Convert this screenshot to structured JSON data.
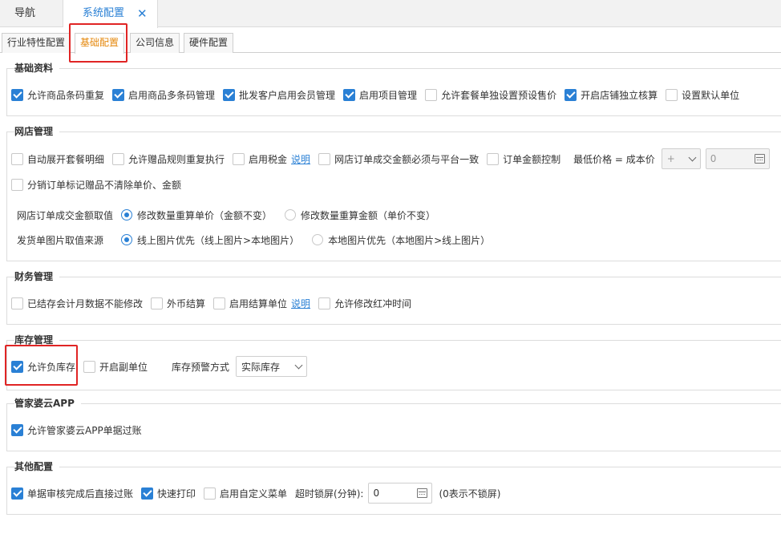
{
  "top_tabs": [
    {
      "label": "导航"
    },
    {
      "label": "系统配置",
      "close": "✕"
    }
  ],
  "sub_tabs": [
    {
      "label": "行业特性配置"
    },
    {
      "label": "基础配置"
    },
    {
      "label": "公司信息"
    },
    {
      "label": "硬件配置"
    }
  ],
  "basic": {
    "title": "基础资料",
    "items": [
      {
        "label": "允许商品条码重复",
        "checked": true
      },
      {
        "label": "启用商品多条码管理",
        "checked": true
      },
      {
        "label": "批发客户启用会员管理",
        "checked": true
      },
      {
        "label": "启用项目管理",
        "checked": true
      },
      {
        "label": "允许套餐单独设置预设售价",
        "checked": false
      },
      {
        "label": "开启店铺独立核算",
        "checked": true
      },
      {
        "label": "设置默认单位",
        "checked": false
      }
    ]
  },
  "online": {
    "title": "网店管理",
    "items": [
      {
        "label": "自动展开套餐明细",
        "checked": false
      },
      {
        "label": "允许赠品规则重复执行",
        "checked": false
      },
      {
        "label": "启用税金",
        "checked": false,
        "link": "说明"
      },
      {
        "label": "网店订单成交金额必须与平台一致",
        "checked": false
      },
      {
        "label": "订单金额控制",
        "checked": false
      }
    ],
    "min_price_label": "最低价格 = 成本价",
    "operator": "+",
    "min_price_value": "0",
    "item2": {
      "label": "分销订单标记赠品不清除单价、金额",
      "checked": false
    },
    "amount_mode": {
      "label": "网店订单成交金额取值",
      "options": [
        {
          "label": "修改数量重算单价（金额不变）",
          "selected": true
        },
        {
          "label": "修改数量重算金额（单价不变）",
          "selected": false
        }
      ]
    },
    "image_source": {
      "label": "发货单图片取值来源",
      "options": [
        {
          "label": "线上图片优先（线上图片>本地图片）",
          "selected": true
        },
        {
          "label": "本地图片优先（本地图片>线上图片）",
          "selected": false
        }
      ]
    }
  },
  "finance": {
    "title": "财务管理",
    "items": [
      {
        "label": "已结存会计月数据不能修改",
        "checked": false
      },
      {
        "label": "外币结算",
        "checked": false
      },
      {
        "label": "启用结算单位",
        "checked": false,
        "link": "说明"
      },
      {
        "label": "允许修改红冲时间",
        "checked": false
      }
    ]
  },
  "stock": {
    "title": "库存管理",
    "items": [
      {
        "label": "允许负库存",
        "checked": true
      },
      {
        "label": "开启副单位",
        "checked": false
      }
    ],
    "warning_label": "库存预警方式",
    "warning_value": "实际库存"
  },
  "app": {
    "title": "管家婆云APP",
    "items": [
      {
        "label": "允许管家婆云APP单据过账",
        "checked": true
      }
    ]
  },
  "other": {
    "title": "其他配置",
    "items": [
      {
        "label": "单据审核完成后直接过账",
        "checked": true
      },
      {
        "label": "快速打印",
        "checked": true
      },
      {
        "label": "启用自定义菜单",
        "checked": false
      }
    ],
    "lock_label": "超时锁屏(分钟):",
    "lock_value": "0",
    "lock_hint": "(0表示不锁屏)"
  },
  "colors": {
    "accent": "#2a80d5",
    "active_subtab": "#e5880d",
    "highlight": "#e02424"
  }
}
